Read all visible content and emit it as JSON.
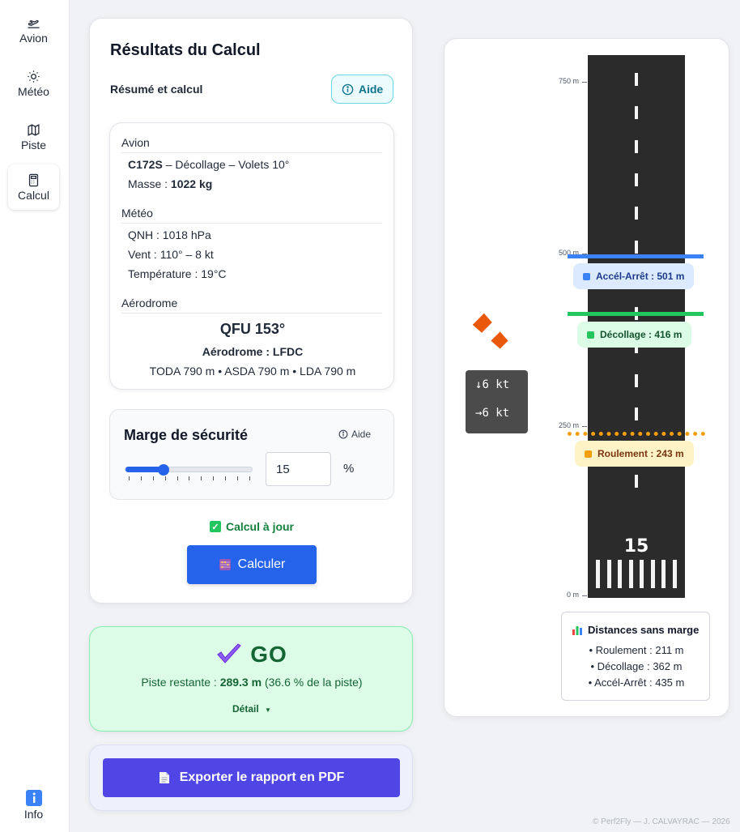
{
  "sidebar": {
    "items": [
      {
        "label": "Avion",
        "icon": "plane-takeoff-icon"
      },
      {
        "label": "Météo",
        "icon": "sun-icon"
      },
      {
        "label": "Piste",
        "icon": "map-icon"
      },
      {
        "label": "Calcul",
        "icon": "calculator-icon",
        "active": true
      }
    ],
    "info_label": "Info"
  },
  "results": {
    "title": "Résultats du Calcul",
    "subtitle": "Résumé et calcul",
    "help_label": "Aide",
    "summary": {
      "aircraft_title": "Avion",
      "aircraft_model": "C172S",
      "aircraft_config": " – Décollage – Volets 10°",
      "mass_label": "Masse : ",
      "mass_value": "1022 kg",
      "weather_title": "Météo",
      "qnh": "QNH : 1018 hPa",
      "wind": "Vent : 110° – 8 kt",
      "temperature": "Température : 19°C",
      "aerodrome_title": "Aérodrome",
      "qfu": "QFU 153°",
      "aerodrome": "Aérodrome : LFDC",
      "distances": "TODA 790 m • ASDA 790 m • LDA 790 m"
    },
    "safety_margin": {
      "title": "Marge de sécurité",
      "help_label": "Aide",
      "value": "15",
      "unit": "%",
      "slider_fraction": 0.3
    },
    "status": "Calcul à jour",
    "calc_button": "Calculer"
  },
  "decision": {
    "verdict": "GO",
    "remaining_label": "Piste restante : ",
    "remaining_value": "289.3 m",
    "remaining_pct": " (36.6 % de la piste)",
    "detail_label": "Détail"
  },
  "export": {
    "button_label": "Exporter le rapport en PDF"
  },
  "runway": {
    "scale_labels": [
      "750 m",
      "500 m",
      "250 m",
      "0 m"
    ],
    "runway_number": "15",
    "markers": [
      {
        "label": "Accél-Arrêt : 501 m",
        "color": "#3b82f6"
      },
      {
        "label": "Décollage : 416 m",
        "color": "#22c55e"
      },
      {
        "label": "Roulement : 243 m",
        "color": "#f59e0b"
      }
    ],
    "wind_head": "6 kt",
    "wind_cross": "6 kt",
    "legend": {
      "title": "Distances sans marge",
      "items": [
        "• Roulement : 211 m",
        "• Décollage : 362 m",
        "• Accél-Arrêt : 435 m"
      ]
    }
  },
  "footer": "© Perf2Fly — J. CALVAYRAC — 2026",
  "colors": {
    "primary": "#2563eb",
    "go_green": "#166534",
    "export": "#4f46e5"
  }
}
